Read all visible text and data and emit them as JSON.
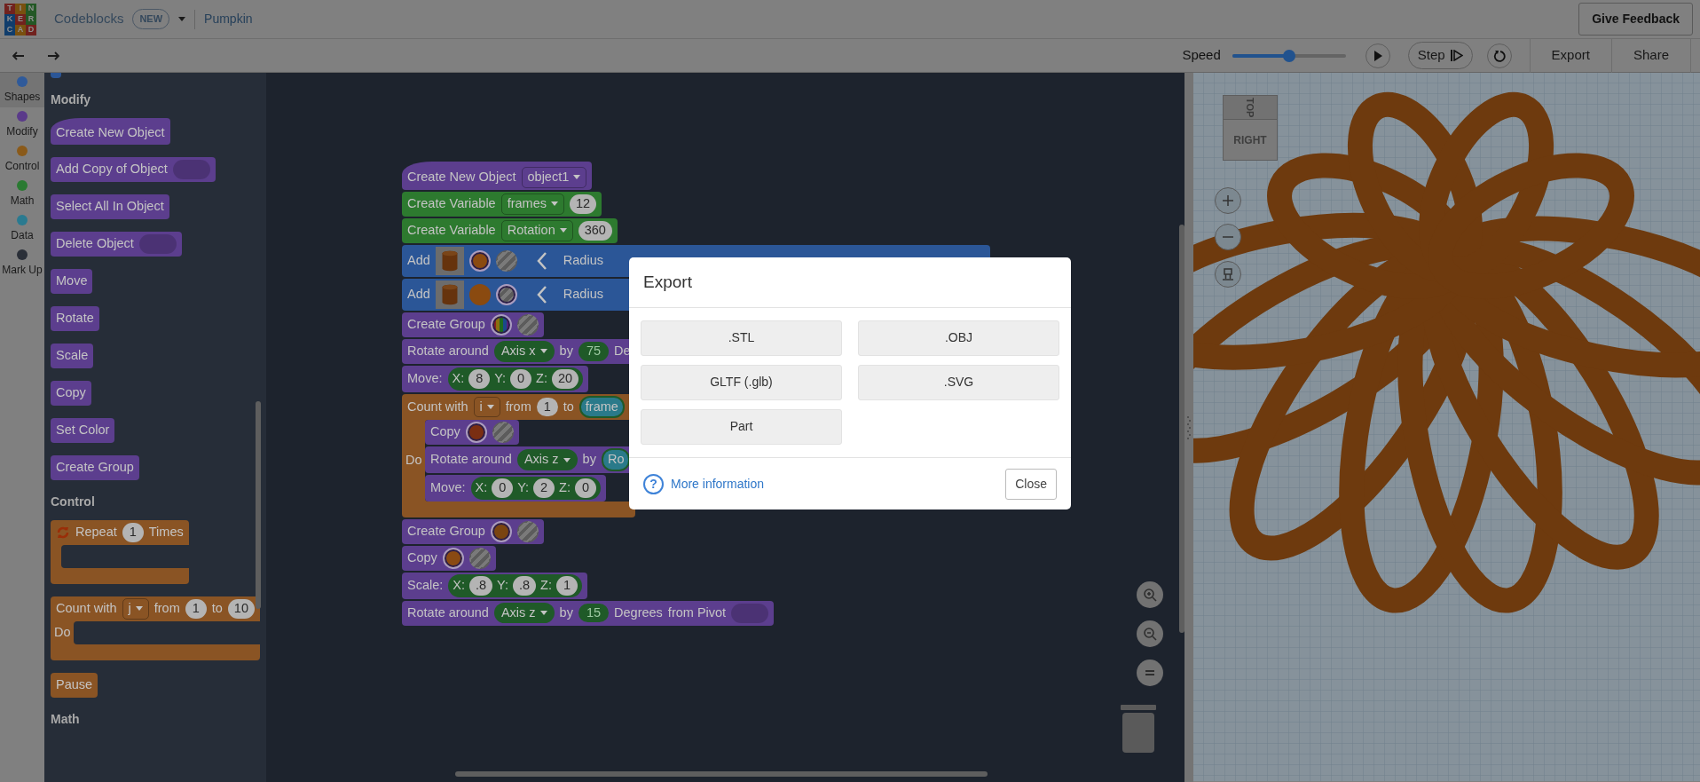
{
  "topbar": {
    "logo": [
      "T",
      "I",
      "N",
      "K",
      "E",
      "R",
      "C",
      "A",
      "D"
    ],
    "app": "Codeblocks",
    "badge": "NEW",
    "project": "Pumpkin",
    "feedback": "Give Feedback"
  },
  "toolbar": {
    "speed_label": "Speed",
    "speed": {
      "level": 0.5
    },
    "step": "Step",
    "export": "Export",
    "share": "Share"
  },
  "categories": [
    {
      "label": "Shapes",
      "color": "#2f5a9a",
      "selected": true
    },
    {
      "label": "Modify",
      "color": "#5a3a8a",
      "selected": false
    },
    {
      "label": "Control",
      "color": "#8a5a1a",
      "selected": false
    },
    {
      "label": "Math",
      "color": "#2a7a32",
      "selected": false
    },
    {
      "label": "Data",
      "color": "#2a7a90",
      "selected": false
    },
    {
      "label": "Mark Up",
      "color": "#2a2f38",
      "selected": false
    }
  ],
  "palette": {
    "sections": [
      {
        "blocks": [
          {
            "kind": "stack",
            "color": "#2b5697"
          }
        ]
      },
      {
        "title": "Modify",
        "blocks": [
          {
            "kind": "hat",
            "color": "#5c3e8e",
            "parts": [
              {
                "kind": "label",
                "text": "Create New Object"
              }
            ]
          },
          {
            "kind": "stack",
            "color": "#5c3e8e",
            "parts": [
              {
                "kind": "label",
                "text": "Add Copy of Object"
              },
              {
                "kind": "slot"
              }
            ]
          },
          {
            "kind": "stack",
            "color": "#5c3e8e",
            "parts": [
              {
                "kind": "label",
                "text": "Select All In Object"
              }
            ]
          },
          {
            "kind": "stack",
            "color": "#5c3e8e",
            "parts": [
              {
                "kind": "label",
                "text": "Delete Object"
              },
              {
                "kind": "slot"
              }
            ]
          },
          {
            "kind": "stack",
            "color": "#5c3e8e",
            "parts": [
              {
                "kind": "label",
                "text": "Move"
              }
            ]
          },
          {
            "kind": "stack",
            "color": "#5c3e8e",
            "parts": [
              {
                "kind": "label",
                "text": "Rotate"
              }
            ]
          },
          {
            "kind": "stack",
            "color": "#5c3e8e",
            "parts": [
              {
                "kind": "label",
                "text": "Scale"
              }
            ]
          },
          {
            "kind": "stack",
            "color": "#5c3e8e",
            "parts": [
              {
                "kind": "label",
                "text": "Copy"
              }
            ]
          },
          {
            "kind": "stack",
            "color": "#5c3e8e",
            "parts": [
              {
                "kind": "label",
                "text": "Set Color"
              }
            ]
          },
          {
            "kind": "stack",
            "color": "#5c3e8e",
            "parts": [
              {
                "kind": "label",
                "text": "Create Group"
              }
            ]
          }
        ]
      },
      {
        "title": "Control",
        "blocks": [
          {
            "kind": "c",
            "color": "#8a5424",
            "parts": [
              {
                "kind": "loop"
              },
              {
                "kind": "label",
                "text": "Repeat"
              },
              {
                "kind": "number",
                "text": "1"
              },
              {
                "kind": "label",
                "text": "Times"
              }
            ]
          },
          {
            "kind": "c",
            "color": "#8a5424",
            "parts": [
              {
                "kind": "label",
                "text": "Count with"
              },
              {
                "kind": "dropdown",
                "text": "j"
              },
              {
                "kind": "label",
                "text": "from"
              },
              {
                "kind": "number",
                "text": "1"
              },
              {
                "kind": "label",
                "text": "to"
              },
              {
                "kind": "number",
                "text": "10"
              }
            ],
            "do_label": "Do"
          },
          {
            "kind": "stack",
            "color": "#8a5424",
            "parts": [
              {
                "kind": "label",
                "text": "Pause"
              }
            ]
          }
        ]
      },
      {
        "title": "Math"
      }
    ]
  },
  "workspace": {
    "blocks": [
      {
        "kind": "hat",
        "color": "#5c3e8e",
        "parts": [
          {
            "kind": "label",
            "text": "Create New Object"
          },
          {
            "kind": "dropdown",
            "text": "object1"
          }
        ]
      },
      {
        "kind": "stack",
        "color": "#2d7a2f",
        "parts": [
          {
            "kind": "label",
            "text": "Create Variable"
          },
          {
            "kind": "dropdown",
            "text": "frames"
          },
          {
            "kind": "number",
            "text": "12"
          }
        ]
      },
      {
        "kind": "stack",
        "color": "#2d7a2f",
        "parts": [
          {
            "kind": "label",
            "text": "Create Variable"
          },
          {
            "kind": "dropdown",
            "text": "Rotation"
          },
          {
            "kind": "number",
            "text": "360"
          }
        ]
      },
      {
        "kind": "wide",
        "color": "#2b5697",
        "parts": [
          {
            "kind": "label",
            "text": "Add"
          },
          {
            "kind": "thumb"
          },
          {
            "kind": "swatch",
            "color": "#8a4a10",
            "selected": true
          },
          {
            "kind": "hole",
            "selected": false
          },
          {
            "kind": "chevron"
          },
          {
            "kind": "label",
            "text": "Radius"
          }
        ]
      },
      {
        "kind": "wide",
        "color": "#2b5697",
        "parts": [
          {
            "kind": "label",
            "text": "Add"
          },
          {
            "kind": "thumb"
          },
          {
            "kind": "swatch",
            "color": "#8a4a10",
            "selected": false
          },
          {
            "kind": "hole",
            "selected": true
          },
          {
            "kind": "chevron"
          },
          {
            "kind": "label",
            "text": "Radius"
          }
        ]
      },
      {
        "kind": "stack",
        "color": "#5c3e8e",
        "parts": [
          {
            "kind": "label",
            "text": "Create Group"
          },
          {
            "kind": "multi",
            "selected": true
          },
          {
            "kind": "hole",
            "selected": false
          }
        ]
      },
      {
        "kind": "stack",
        "color": "#5c3e8e",
        "parts": [
          {
            "kind": "label",
            "text": "Rotate around"
          },
          {
            "kind": "axis",
            "text": "Axis x"
          },
          {
            "kind": "label",
            "text": "by"
          },
          {
            "kind": "angle",
            "text": "75"
          },
          {
            "kind": "label",
            "text": "De"
          }
        ]
      },
      {
        "kind": "stack",
        "color": "#5c3e8e",
        "parts": [
          {
            "kind": "label",
            "text": "Move:"
          },
          {
            "kind": "coords",
            "items": [
              {
                "axis": "X:",
                "value": "8"
              },
              {
                "axis": "Y:",
                "value": "0"
              },
              {
                "axis": "Z:",
                "value": "20"
              }
            ]
          }
        ]
      },
      {
        "kind": "c",
        "color": "#8a5424",
        "parts": [
          {
            "kind": "label",
            "text": "Count with"
          },
          {
            "kind": "dropdown",
            "text": "i"
          },
          {
            "kind": "label",
            "text": "from"
          },
          {
            "kind": "number",
            "text": "1"
          },
          {
            "kind": "label",
            "text": "to"
          },
          {
            "kind": "var",
            "text": "frame"
          }
        ],
        "do_label": "Do",
        "children": [
          {
            "kind": "stack",
            "color": "#5c3e8e",
            "parts": [
              {
                "kind": "label",
                "text": "Copy"
              },
              {
                "kind": "swatch",
                "color": "#7a2e12",
                "selected": true
              },
              {
                "kind": "hole",
                "selected": false
              }
            ]
          },
          {
            "kind": "stack",
            "color": "#5c3e8e",
            "parts": [
              {
                "kind": "label",
                "text": "Rotate around"
              },
              {
                "kind": "axis",
                "text": "Axis z"
              },
              {
                "kind": "label",
                "text": "by"
              },
              {
                "kind": "var",
                "text": "Ro"
              }
            ]
          },
          {
            "kind": "stack",
            "color": "#5c3e8e",
            "parts": [
              {
                "kind": "label",
                "text": "Move:"
              },
              {
                "kind": "coords",
                "items": [
                  {
                    "axis": "X:",
                    "value": "0"
                  },
                  {
                    "axis": "Y:",
                    "value": "2"
                  },
                  {
                    "axis": "Z:",
                    "value": "0"
                  }
                ]
              }
            ]
          }
        ]
      },
      {
        "kind": "stack",
        "color": "#5c3e8e",
        "parts": [
          {
            "kind": "label",
            "text": "Create Group"
          },
          {
            "kind": "swatch",
            "color": "#7a4410",
            "selected": true
          },
          {
            "kind": "hole",
            "selected": false
          }
        ]
      },
      {
        "kind": "stack",
        "color": "#5c3e8e",
        "parts": [
          {
            "kind": "label",
            "text": "Copy"
          },
          {
            "kind": "swatch",
            "color": "#8a4a12",
            "selected": true
          },
          {
            "kind": "hole",
            "selected": false
          }
        ]
      },
      {
        "kind": "stack",
        "color": "#5c3e8e",
        "parts": [
          {
            "kind": "label",
            "text": "Scale:"
          },
          {
            "kind": "coords",
            "items": [
              {
                "axis": "X:",
                "value": ".8"
              },
              {
                "axis": "Y:",
                "value": ".8"
              },
              {
                "axis": "Z:",
                "value": "1"
              }
            ]
          }
        ]
      },
      {
        "kind": "stack",
        "color": "#5c3e8e",
        "parts": [
          {
            "kind": "label",
            "text": "Rotate around"
          },
          {
            "kind": "axis",
            "text": "Axis z"
          },
          {
            "kind": "label",
            "text": "by"
          },
          {
            "kind": "angle",
            "text": "15"
          },
          {
            "kind": "label",
            "text": "Degrees"
          },
          {
            "kind": "label",
            "text": "from Pivot"
          },
          {
            "kind": "slot"
          }
        ]
      }
    ]
  },
  "viewport": {
    "cube_top": "TOP",
    "cube_front": "RIGHT"
  },
  "dialog": {
    "title": "Export",
    "options": [
      ".STL",
      ".OBJ",
      "GLTF (.glb)",
      ".SVG",
      "Part"
    ],
    "help_icon": "?",
    "help_link": "More information",
    "close": "Close"
  }
}
